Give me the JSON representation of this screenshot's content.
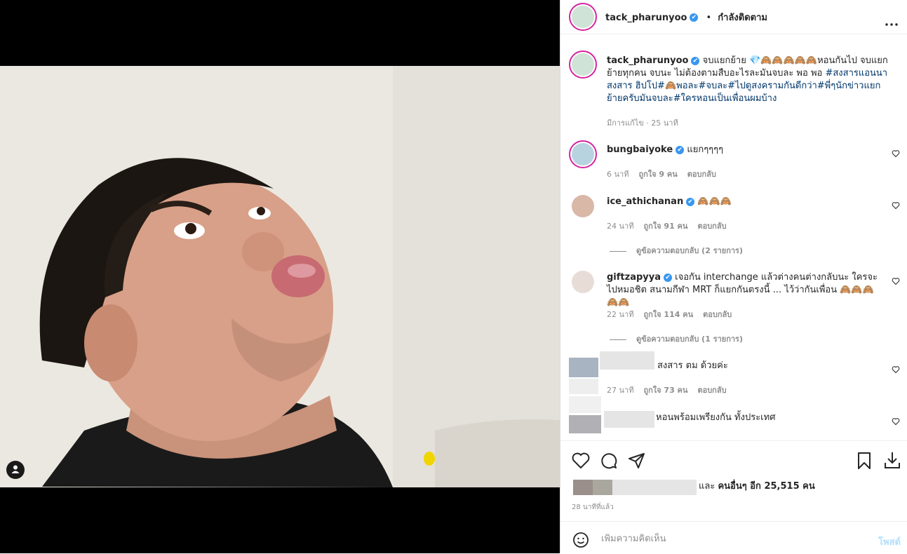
{
  "header": {
    "username": "tack_pharunyoo",
    "verified_mark": "✔",
    "separator": "•",
    "follow_status": "กำลังติดตาม",
    "more_icon": "more-horizontal-icon"
  },
  "caption": {
    "username": "tack_pharunyoo",
    "text_plain_1": "จบแยกย้าย 💎🙈🙈🙈🙈🙈หอนกันไป จบแยกย้ายทุกคน จบนะ ไม่ต้องตามสืบอะไรละมันจบละ พอ พอ ",
    "hashtags_1": "#สงสารแอนนาสงสาร ฮิปโป#🙈พอละ#จบละ#ไปดูสงครามกันดีกว่า#พี่ๆนักข่าวแยกย้ายครับมันจบละ#ใครหอนเป็นเพื่อนผมบ้าง",
    "edited": "มีการแก้ไข · 25 นาที"
  },
  "comments": [
    {
      "username": "bungbaiyoke",
      "text": "แยกๆๆๆๆ",
      "time": "6 นาที",
      "likes": "ถูกใจ 9 คน",
      "reply": "ตอบกลับ"
    },
    {
      "username": "ice_athichanan",
      "text": "🙈🙈🙈",
      "time": "24 นาที",
      "likes": "ถูกใจ 91 คน",
      "reply": "ตอบกลับ",
      "view_replies": "ดูข้อความตอบกลับ (2 รายการ)"
    },
    {
      "username": "giftzapyya",
      "text": "เจอกัน interchange แล้วต่างคนต่างกลับนะ ใครจะไปหมอชิต สนามกีฬา MRT ก็แยกกันตรงนี้ ... ไว้ว่ากันเพื่อน 🙈🙈🙈🙈🙈",
      "time": "22 นาที",
      "likes": "ถูกใจ 114 คน",
      "reply": "ตอบกลับ",
      "view_replies": "ดูข้อความตอบกลับ (1 รายการ)"
    },
    {
      "text": "สงสาร ตม ด้วยค่ะ",
      "time": "27 นาที",
      "likes": "ถูกใจ 73 คน",
      "reply": "ตอบกลับ"
    },
    {
      "text": "หอนพร้อมเพรียงกัน ทั้งประเทศ"
    }
  ],
  "likes_summary": {
    "text_and": "และ ",
    "text_others": "คนอื่นๆ อีก 25,515 คน",
    "time": "28 นาทีที่แล้ว"
  },
  "comment_box": {
    "placeholder": "เพิ่มความคิดเห็น",
    "post_label": "โพสต์"
  },
  "colors": {
    "link": "#00376b",
    "verified": "#3897f0",
    "muted": "#8e8e8e",
    "post_disabled": "#b2dffc"
  }
}
